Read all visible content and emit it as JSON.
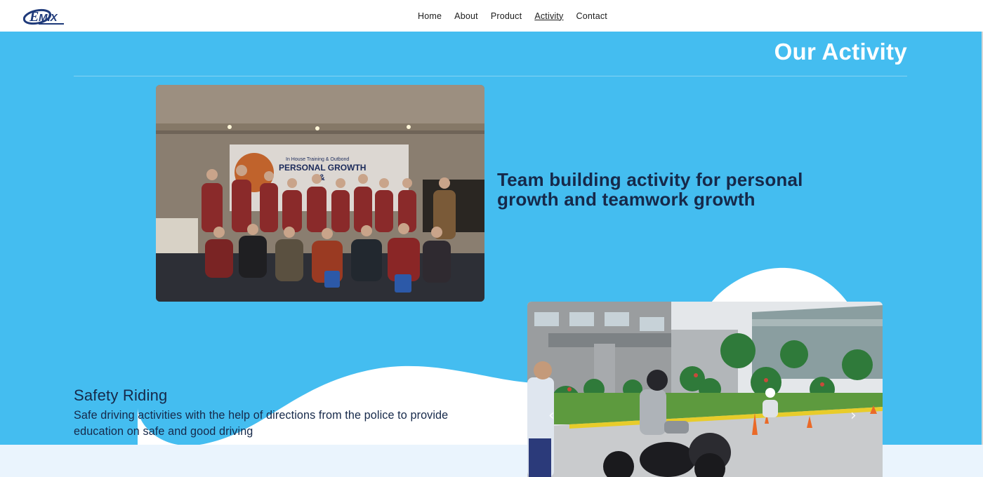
{
  "nav": {
    "logo_text": "EMIX",
    "items": [
      {
        "label": "Home",
        "active": false
      },
      {
        "label": "About",
        "active": false
      },
      {
        "label": "Product",
        "active": false
      },
      {
        "label": "Activity",
        "active": true
      },
      {
        "label": "Contact",
        "active": false
      }
    ]
  },
  "page": {
    "title": "Our Activity"
  },
  "activities": [
    {
      "caption": "Team building activity for personal growth and teamwork growth",
      "banner_line1": "In House Training & Outbond",
      "banner_line2": "PERSONAL GROWTH",
      "banner_line3": "&"
    },
    {
      "title": "Safety Riding",
      "description": "Safe driving activities with the help of directions from the police to provide education on safe and good driving",
      "prev_icon": "chevron-left-icon",
      "next_icon": "chevron-right-icon"
    }
  ],
  "colors": {
    "hero_bg": "#44bdf0",
    "text_dark": "#16294a",
    "page_bg": "#eaf4fd"
  }
}
